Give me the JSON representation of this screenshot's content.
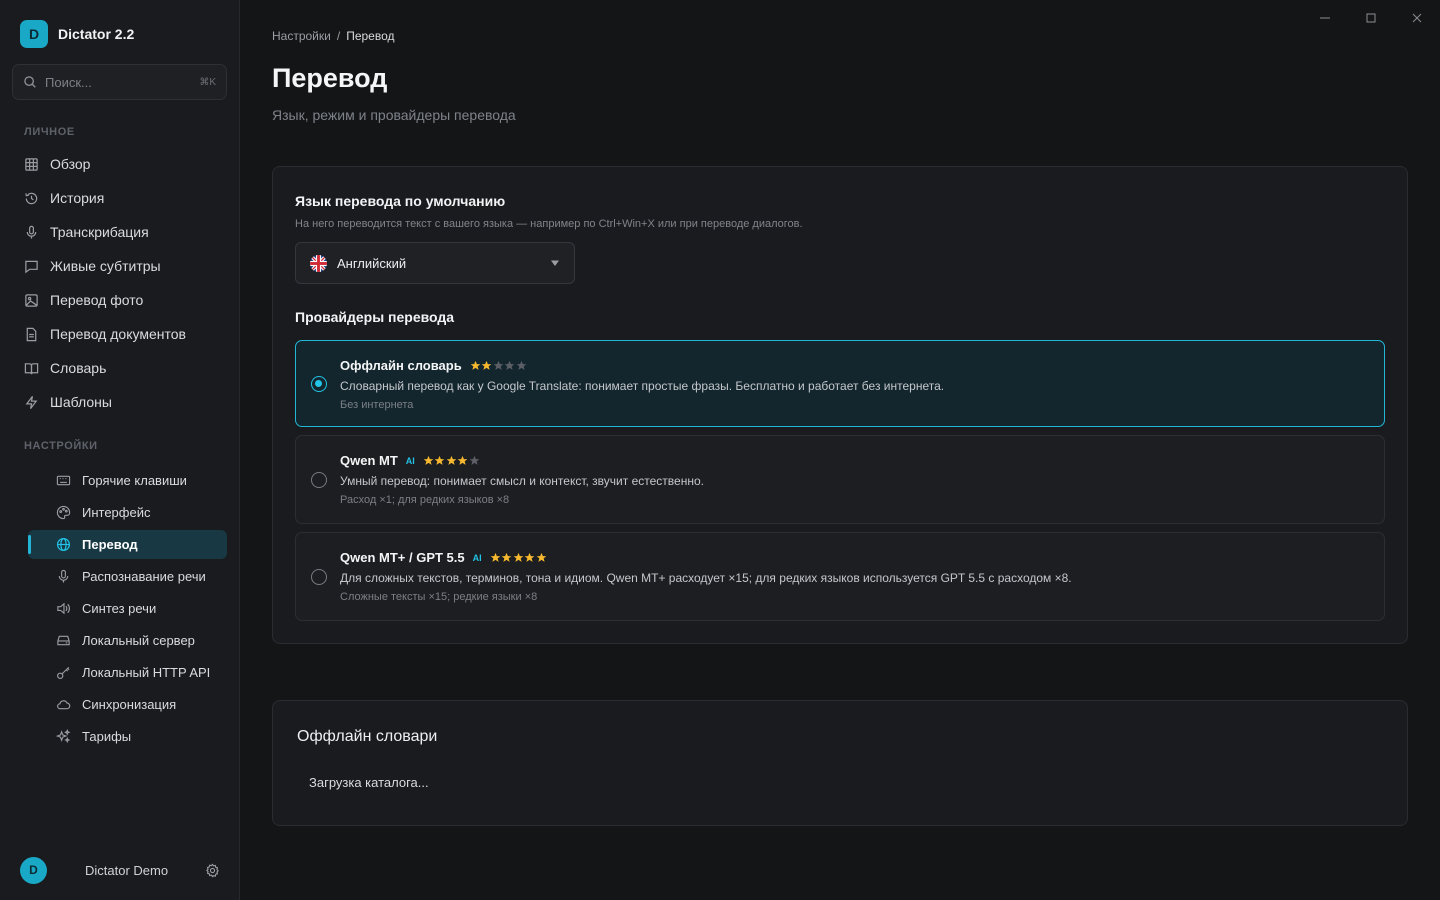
{
  "app": {
    "logo_letter": "D",
    "name": "Dictator 2.2"
  },
  "search": {
    "placeholder": "Поиск...",
    "shortcut": "⌘K"
  },
  "sidebar": {
    "personal_title": "ЛИЧНОЕ",
    "personal_items": [
      {
        "label": "Обзор",
        "icon": "grid-icon"
      },
      {
        "label": "История",
        "icon": "history-icon"
      },
      {
        "label": "Транскрибация",
        "icon": "microphone-icon"
      },
      {
        "label": "Живые субтитры",
        "icon": "chat-icon"
      },
      {
        "label": "Перевод фото",
        "icon": "image-icon"
      },
      {
        "label": "Перевод документов",
        "icon": "document-icon"
      },
      {
        "label": "Словарь",
        "icon": "book-icon"
      },
      {
        "label": "Шаблоны",
        "icon": "bolt-icon"
      }
    ],
    "settings_title": "НАСТРОЙКИ",
    "settings_items": [
      {
        "label": "Горячие клавиши",
        "icon": "keyboard-icon"
      },
      {
        "label": "Интерфейс",
        "icon": "palette-icon"
      },
      {
        "label": "Перевод",
        "icon": "globe-icon",
        "active": true
      },
      {
        "label": "Распознавание речи",
        "icon": "microphone-icon"
      },
      {
        "label": "Синтез речи",
        "icon": "speaker-icon"
      },
      {
        "label": "Локальный сервер",
        "icon": "server-icon"
      },
      {
        "label": "Локальный HTTP API",
        "icon": "key-icon"
      },
      {
        "label": "Синхронизация",
        "icon": "cloud-icon"
      },
      {
        "label": "Тарифы",
        "icon": "sparkle-icon"
      }
    ]
  },
  "user": {
    "initial": "D",
    "name": "Dictator Demo"
  },
  "breadcrumb": {
    "parent": "Настройки",
    "separator": "/",
    "current": "Перевод"
  },
  "page": {
    "title": "Перевод",
    "subtitle": "Язык, режим и провайдеры перевода"
  },
  "default_language": {
    "label": "Язык перевода по умолчанию",
    "hint": "На него переводится текст с вашего языка — например по Ctrl+Win+X или при переводе диалогов.",
    "value": "Английский"
  },
  "providers": {
    "label": "Провайдеры перевода",
    "items": [
      {
        "title": "Оффлайн словарь",
        "ai": "",
        "rating": 2,
        "max_rating": 5,
        "selected": true,
        "description": "Словарный перевод как у Google Translate: понимает простые фразы. Бесплатно и работает без интернета.",
        "meta": "Без интернета"
      },
      {
        "title": "Qwen MT",
        "ai": "AI",
        "rating": 4,
        "max_rating": 5,
        "selected": false,
        "description": "Умный перевод: понимает смысл и контекст, звучит естественно.",
        "meta": "Расход ×1; для редких языков ×8"
      },
      {
        "title": "Qwen MT+ / GPT 5.5",
        "ai": "AI",
        "rating": 5,
        "max_rating": 5,
        "selected": false,
        "description": "Для сложных текстов, терминов, тона и идиом. Qwen MT+ расходует ×15; для редких языков используется GPT 5.5 с расходом ×8.",
        "meta": "Сложные тексты ×15; редкие языки ×8"
      }
    ]
  },
  "offline_dicts": {
    "title": "Оффлайн словари",
    "status": "Загрузка каталога..."
  },
  "colors": {
    "accent": "#22b6d6",
    "star_on": "#f5b82e",
    "star_off": "#5c5f66",
    "background": "#141517",
    "panel": "#1a1b1e"
  }
}
